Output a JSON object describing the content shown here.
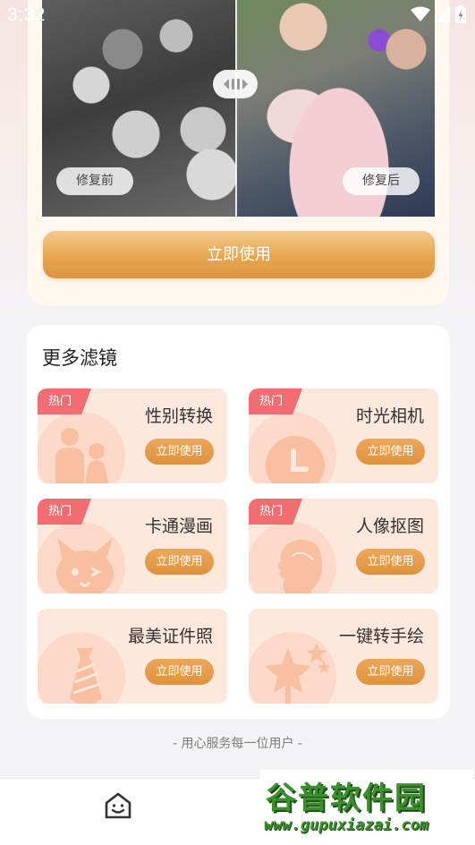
{
  "status_bar": {
    "time": "3:32",
    "icons": [
      "sim-icon",
      "wifi-icon",
      "signal-icon",
      "battery-icon"
    ]
  },
  "compare": {
    "before_label": "修复前",
    "after_label": "修复后"
  },
  "primary_action": {
    "label": "立即使用"
  },
  "filters": {
    "title": "更多滤镜",
    "items": [
      {
        "name": "性别转换",
        "hot": "热门",
        "button": "立即使用",
        "icon": "people-icon"
      },
      {
        "name": "时光相机",
        "hot": "热门",
        "button": "立即使用",
        "icon": "clock-icon"
      },
      {
        "name": "卡通漫画",
        "hot": "热门",
        "button": "立即使用",
        "icon": "cartoon-rabbit-icon"
      },
      {
        "name": "人像抠图",
        "hot": "热门",
        "button": "立即使用",
        "icon": "profile-silhouette-icon"
      },
      {
        "name": "最美证件照",
        "button": "立即使用",
        "icon": "necktie-icon"
      },
      {
        "name": "一键转手绘",
        "button": "立即使用",
        "icon": "star-wand-icon"
      }
    ]
  },
  "footer_note": "- 用心服务每一位用户 -",
  "bottom_nav": {
    "home_icon": "home-smile-icon"
  },
  "watermark": {
    "title": "谷普软件园",
    "url": "www.gupuxiazai.com"
  },
  "colors": {
    "accent": "#e49a45",
    "hot_tag": "#f26d71",
    "tile_bg": "#fde8dd"
  }
}
